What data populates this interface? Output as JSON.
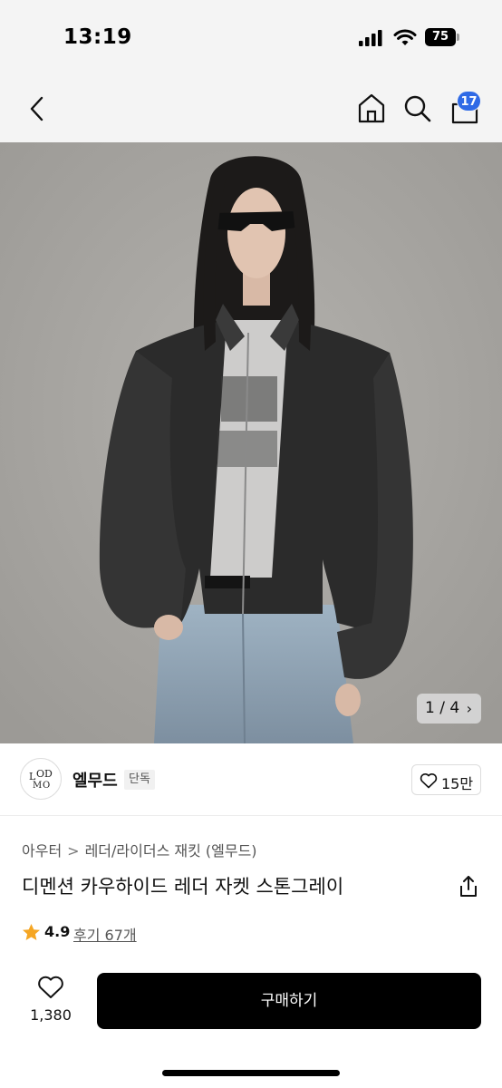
{
  "status_bar": {
    "time": "13:19",
    "battery_level": "75",
    "icons": [
      "signal-icon",
      "wifi-icon",
      "battery-icon"
    ]
  },
  "nav": {
    "icons": [
      "back-icon",
      "home-icon",
      "search-icon",
      "cart-icon"
    ],
    "cart_badge": "17",
    "badge_color": "#2f6ae6"
  },
  "gallery": {
    "current": "1",
    "total": "4",
    "indicator": "1 / 4",
    "next_arrow": "›"
  },
  "brand": {
    "logo_text": "LMOOD",
    "name": "엘무드",
    "tag": "단독",
    "likes": "15만"
  },
  "product": {
    "category": "아우터",
    "subcategory": "레더/라이더스 재킷 (엘무드)",
    "breadcrumb_separator": ">",
    "title": "디멘션 카우하이드 레더 자켓 스톤그레이"
  },
  "rating": {
    "score": "4.9",
    "reviews": "후기 67개",
    "star_color": "#f5a623"
  },
  "bottom_bar": {
    "wishlist_count": "1,380",
    "buy_label": "구매하기",
    "buy_color": "#000000"
  }
}
